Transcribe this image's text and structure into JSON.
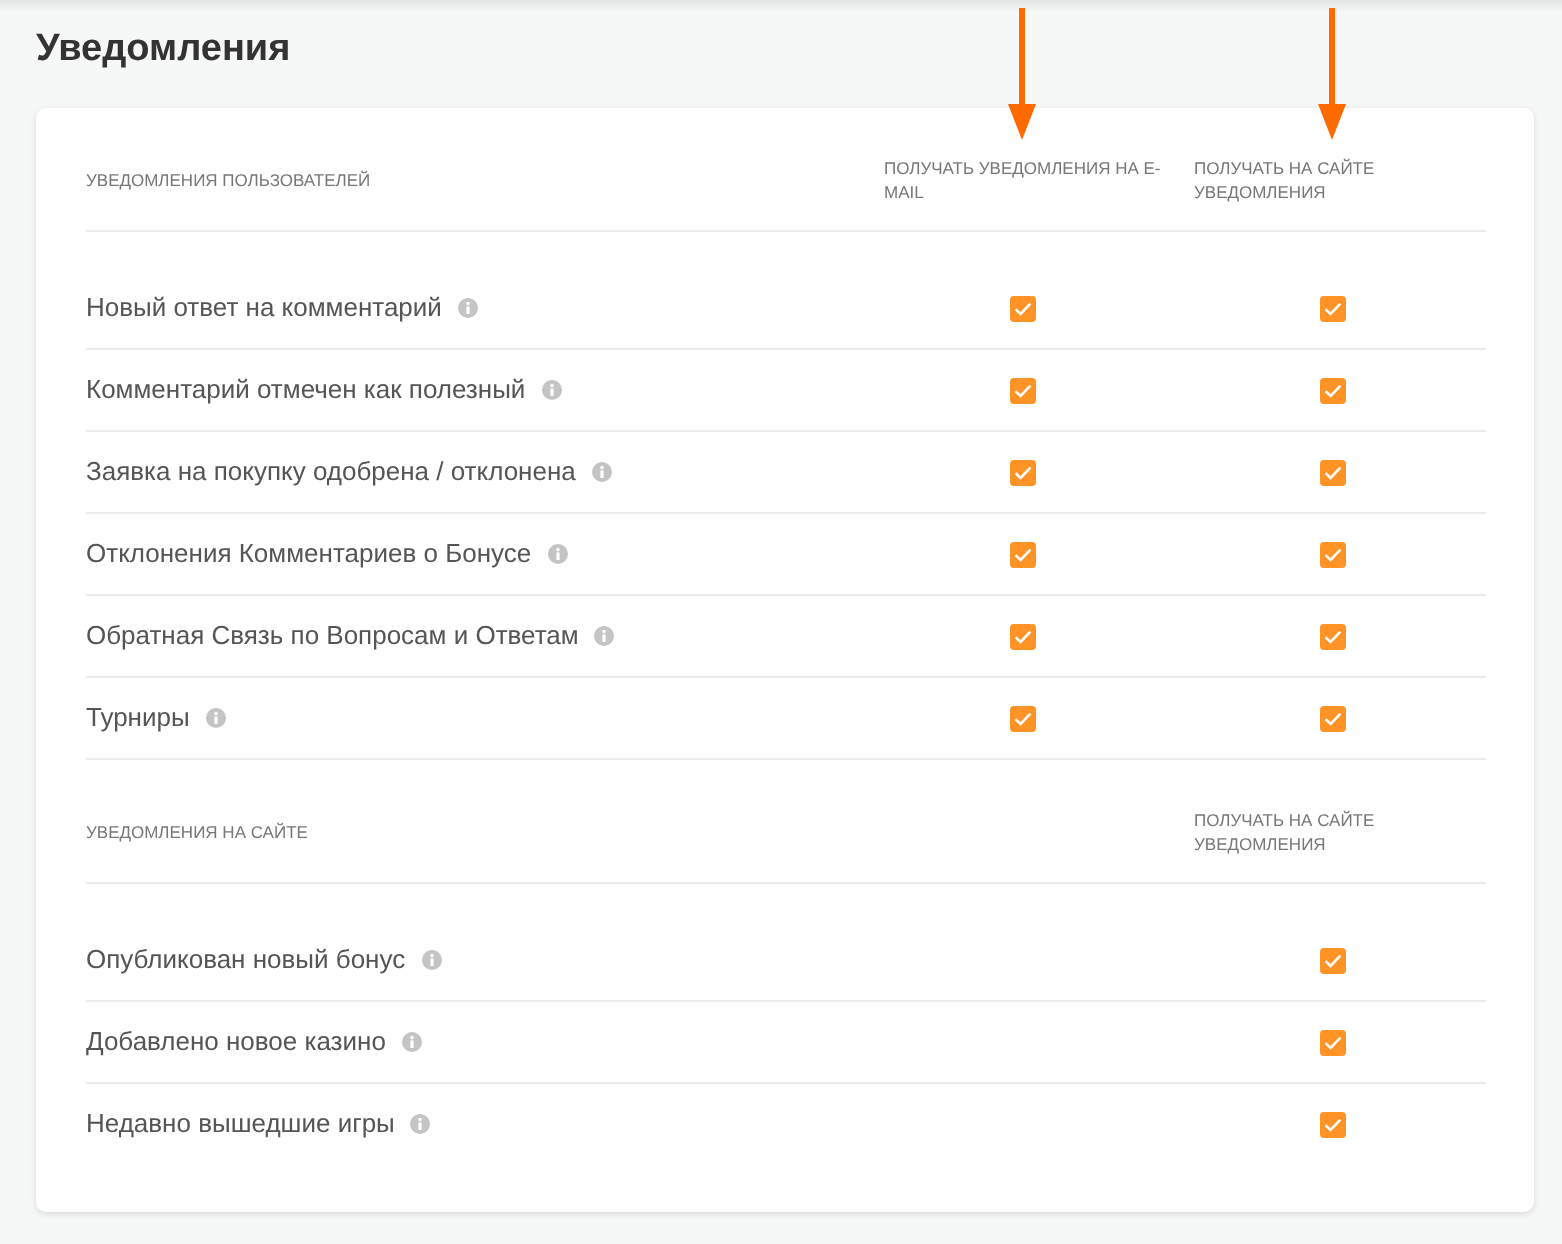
{
  "page": {
    "title": "Уведомления"
  },
  "sections": [
    {
      "heading": "УВЕДОМЛЕНИЯ ПОЛЬЗОВАТЕЛЕЙ",
      "columns": [
        {
          "kind": "email",
          "label": "ПОЛУЧАТЬ УВЕДОМЛЕНИЯ НА E-MAIL",
          "arrow": true
        },
        {
          "kind": "site",
          "label": "ПОЛУЧАТЬ НА САЙТЕ УВЕДОМЛЕНИЯ",
          "arrow": true
        }
      ],
      "rows": [
        {
          "label": "Новый ответ на комментарий",
          "options": [
            {
              "checked": true
            },
            {
              "checked": true
            }
          ]
        },
        {
          "label": "Комментарий отмечен как полезный",
          "options": [
            {
              "checked": true
            },
            {
              "checked": true
            }
          ]
        },
        {
          "label": "Заявка на покупку одобрена / отклонена",
          "options": [
            {
              "checked": true
            },
            {
              "checked": true
            }
          ]
        },
        {
          "label": "Отклонения Комментариев о Бонусе",
          "options": [
            {
              "checked": true
            },
            {
              "checked": true
            }
          ]
        },
        {
          "label": "Обратная Связь по Вопросам и Ответам",
          "options": [
            {
              "checked": true
            },
            {
              "checked": true
            }
          ]
        },
        {
          "label": "Турниры",
          "options": [
            {
              "checked": true
            },
            {
              "checked": true
            }
          ]
        }
      ]
    },
    {
      "heading": "УВЕДОМЛЕНИЯ НА САЙТЕ",
      "columns": [
        {
          "kind": "site",
          "label": "ПОЛУЧАТЬ НА САЙТЕ УВЕДОМЛЕНИЯ",
          "arrow": false
        }
      ],
      "rows": [
        {
          "label": "Опубликован новый бонус",
          "options": [
            {
              "checked": true
            }
          ]
        },
        {
          "label": "Добавлено новое казино",
          "options": [
            {
              "checked": true
            }
          ]
        },
        {
          "label": "Недавно вышедшие игры",
          "options": [
            {
              "checked": true
            }
          ]
        }
      ]
    }
  ]
}
